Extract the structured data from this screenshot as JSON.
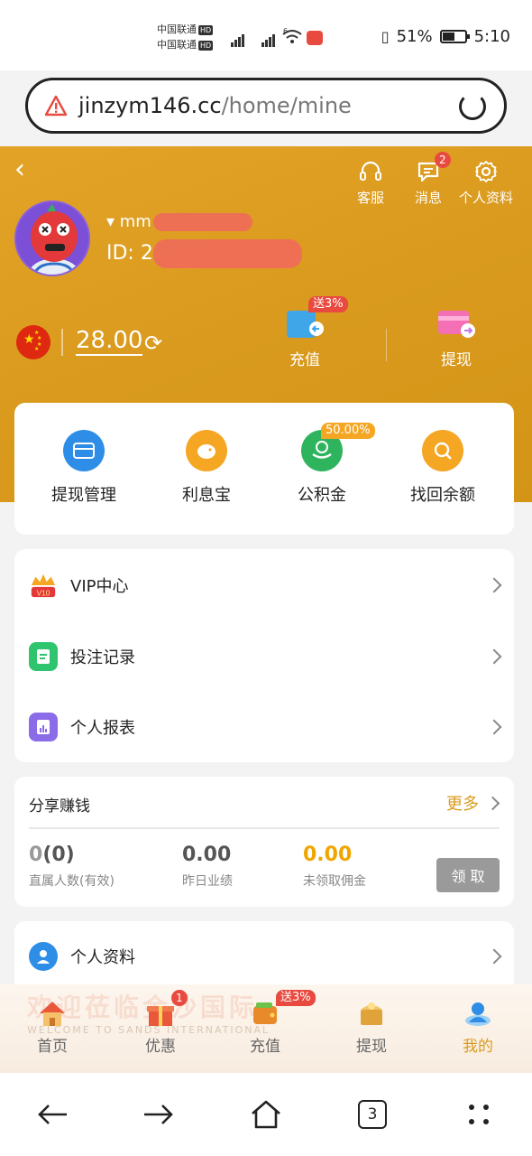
{
  "status": {
    "carrier1": "中国联通",
    "carrier2": "中国联通",
    "hd": "HD",
    "wifi_sup": "6",
    "battery": "51%",
    "time": "5:10"
  },
  "browser": {
    "url_host": "jinzym146.cc",
    "url_path": "/home/mine",
    "tab_count": "3"
  },
  "header": {
    "top_icons": [
      {
        "label": "客服"
      },
      {
        "label": "消息",
        "badge": "2"
      },
      {
        "label": "个人资料"
      }
    ],
    "username": "mm",
    "user_id": "ID: 2",
    "balance": "28.00",
    "recharge": {
      "label": "充值",
      "badge": "送3%"
    },
    "withdraw": {
      "label": "提现"
    }
  },
  "quick": [
    {
      "label": "提现管理"
    },
    {
      "label": "利息宝"
    },
    {
      "label": "公积金",
      "badge": "50.00%"
    },
    {
      "label": "找回余额"
    }
  ],
  "menu": [
    {
      "label": "VIP中心",
      "vip": "V10"
    },
    {
      "label": "投注记录"
    },
    {
      "label": "个人报表"
    }
  ],
  "share": {
    "title": "分享赚钱",
    "more": "更多",
    "stats": [
      {
        "value_main": "0",
        "value_paren": "(0)",
        "label": "直属人数(有效)"
      },
      {
        "value_main": "0.00",
        "label": "昨日业绩"
      },
      {
        "value_main": "0.00",
        "label": "未领取佣金"
      }
    ],
    "claim": "领 取"
  },
  "profile_row": {
    "label": "个人资料"
  },
  "tabbar": {
    "watermark": "欢迎莅临金沙国际",
    "watermark_en": "WELCOME TO SANDS INTERNATIONAL",
    "items": [
      {
        "label": "首页"
      },
      {
        "label": "优惠",
        "badge": "1"
      },
      {
        "label": "充值",
        "badge": "送3%"
      },
      {
        "label": "提现"
      },
      {
        "label": "我的"
      }
    ]
  },
  "colors": {
    "header": "#dd9d22",
    "accent": "#d89b20",
    "badge": "#e94a3f",
    "yellow_value": "#f0a500"
  }
}
